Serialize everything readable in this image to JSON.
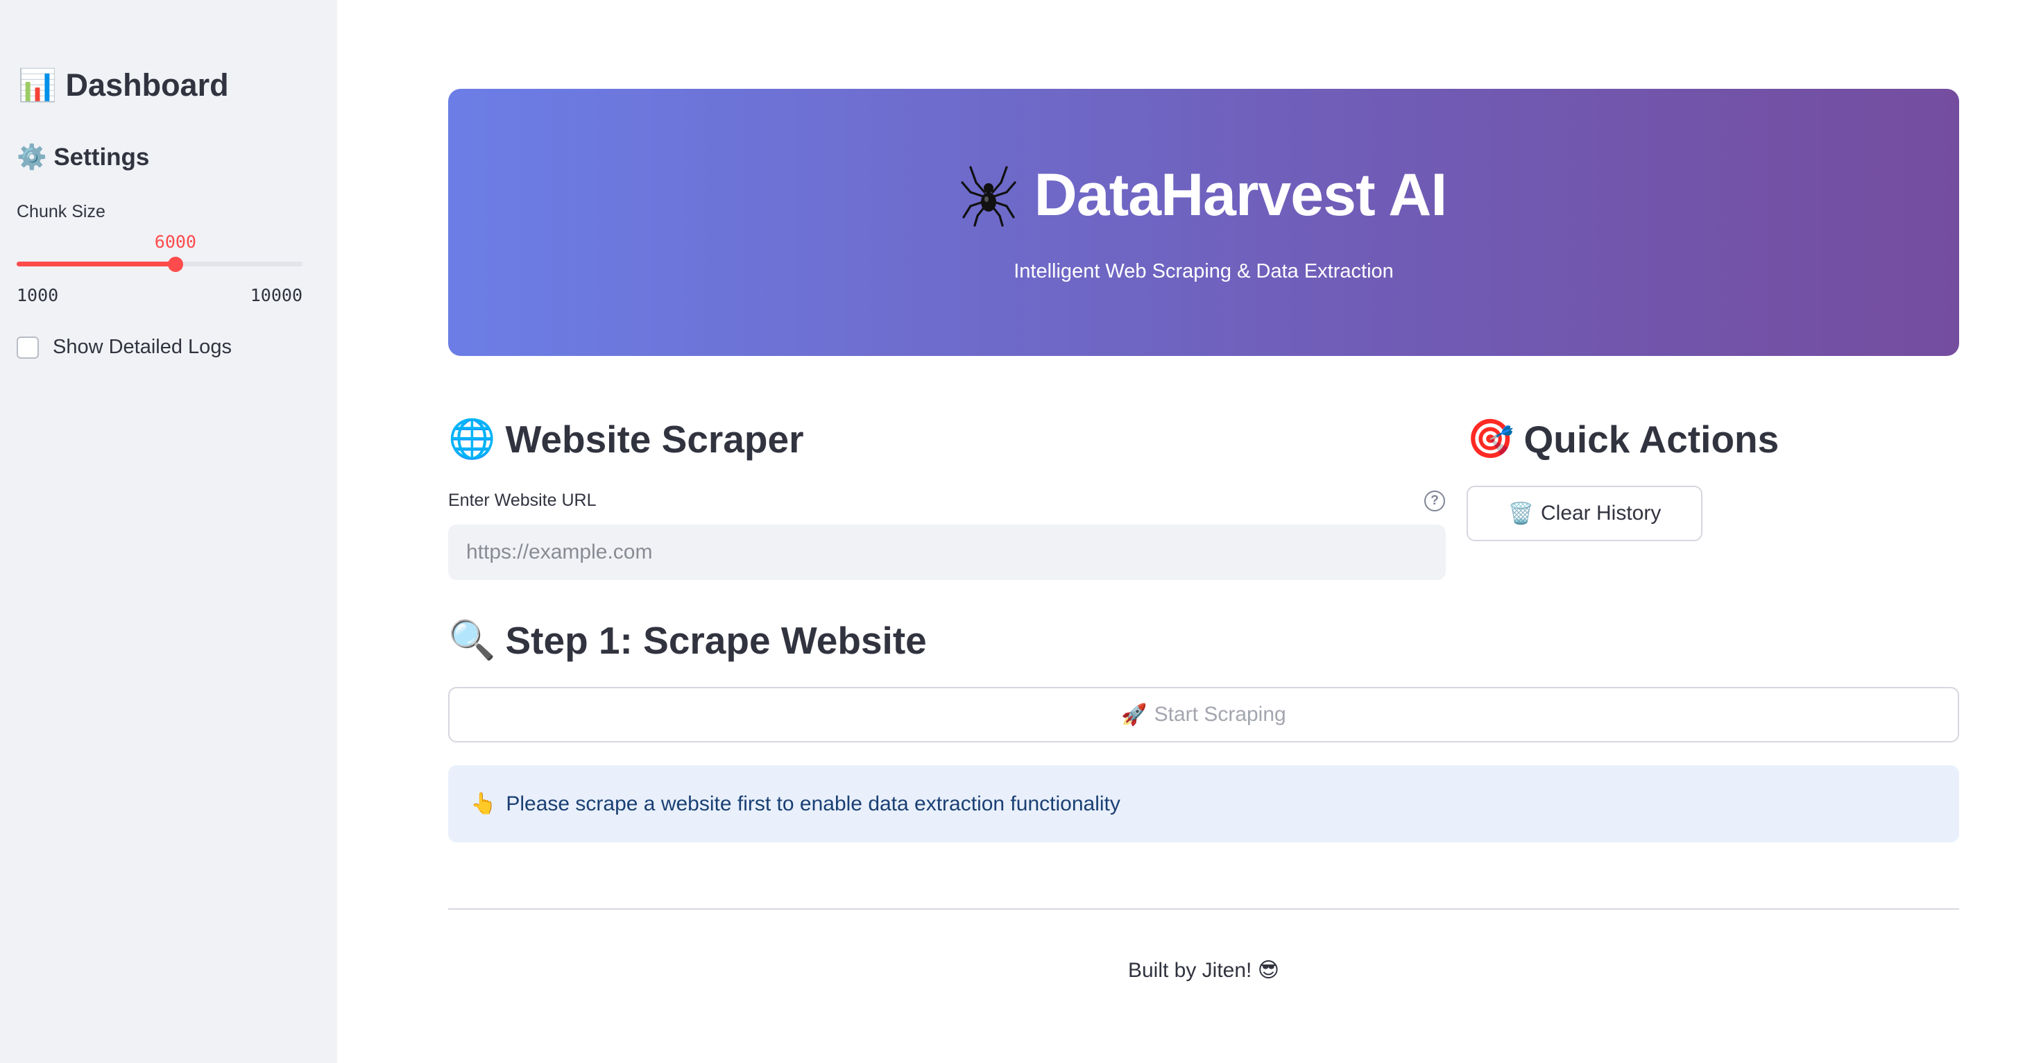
{
  "sidebar": {
    "title_icon": "📊",
    "title": "Dashboard",
    "settings_icon": "⚙️",
    "settings": "Settings",
    "chunk_size": {
      "label": "Chunk Size",
      "value": "6000",
      "min_label": "1000",
      "max_label": "10000",
      "min": 1000,
      "max": 10000,
      "current": 6000
    },
    "detailed_logs_label": "Show Detailed Logs",
    "detailed_logs_checked": false
  },
  "hero": {
    "icon": "spider-icon",
    "title": "DataHarvest AI",
    "subtitle": "Intelligent Web Scraping & Data Extraction"
  },
  "scraper": {
    "icon": "🌐",
    "heading": "Website Scraper",
    "url_label": "Enter Website URL",
    "url_placeholder": "https://example.com",
    "url_value": ""
  },
  "quick_actions": {
    "icon": "🎯",
    "heading": "Quick Actions",
    "clear_icon": "🗑️",
    "clear_label": "Clear History"
  },
  "step1": {
    "icon": "🔍",
    "heading": "Step 1: Scrape Website",
    "start_icon": "🚀",
    "start_label": "Start Scraping"
  },
  "info": {
    "icon": "👆",
    "message": "Please scrape a website first to enable data extraction functionality"
  },
  "footer": {
    "text": "Built by Jiten!",
    "emoji": "😎"
  },
  "colors": {
    "accent": "#ff4b4b",
    "hero_gradient_start": "#6c7ee6",
    "hero_gradient_end": "#744d9f",
    "info_bg": "#e9f0fb"
  }
}
